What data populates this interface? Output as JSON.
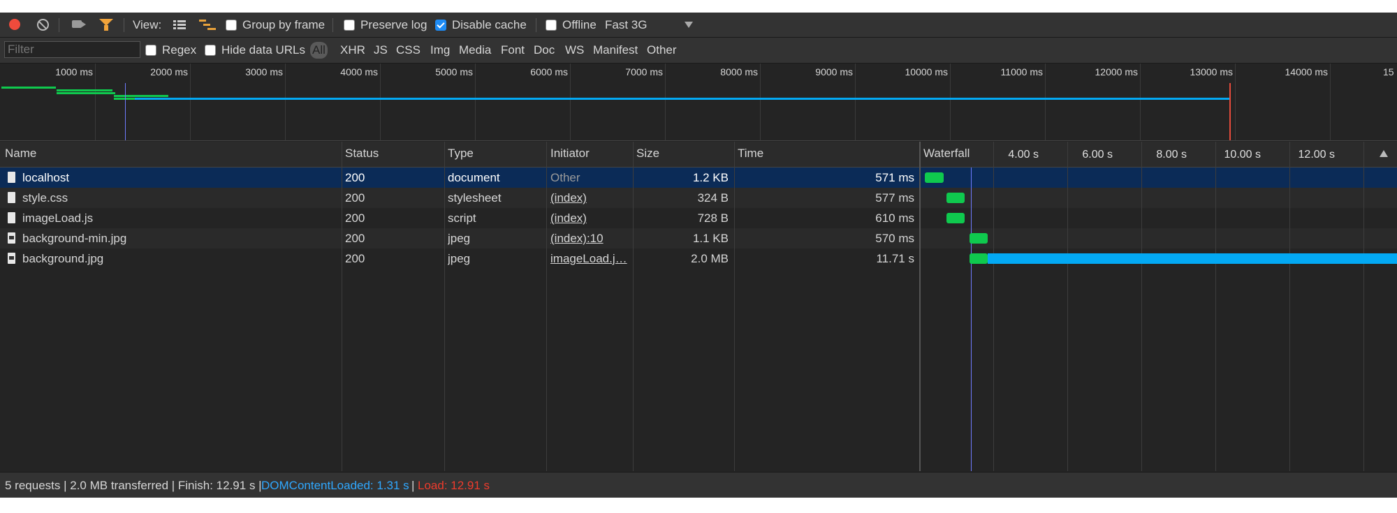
{
  "toolbar": {
    "view_label": "View:",
    "group_by_frame_label": "Group by frame",
    "group_by_frame_checked": false,
    "preserve_log_label": "Preserve log",
    "preserve_log_checked": false,
    "disable_cache_label": "Disable cache",
    "disable_cache_checked": true,
    "offline_label": "Offline",
    "offline_checked": false,
    "throttling_value": "Fast 3G"
  },
  "filterbar": {
    "filter_placeholder": "Filter",
    "filter_value": "",
    "regex_label": "Regex",
    "hide_data_urls_label": "Hide data URLs",
    "types": [
      "All",
      "XHR",
      "JS",
      "CSS",
      "Img",
      "Media",
      "Font",
      "Doc",
      "WS",
      "Manifest",
      "Other"
    ],
    "active_type": "All"
  },
  "overview": {
    "ticks": [
      "1000 ms",
      "2000 ms",
      "3000 ms",
      "4000 ms",
      "5000 ms",
      "6000 ms",
      "7000 ms",
      "8000 ms",
      "9000 ms",
      "10000 ms",
      "11000 ms",
      "12000 ms",
      "13000 ms",
      "14000 ms",
      "15"
    ]
  },
  "table": {
    "columns": {
      "name": "Name",
      "status": "Status",
      "type": "Type",
      "initiator": "Initiator",
      "size": "Size",
      "time": "Time",
      "waterfall": "Waterfall"
    },
    "waterfall_ticks": [
      "4.00 s",
      "6.00 s",
      "8.00 s",
      "10.00 s",
      "12.00 s"
    ],
    "rows": [
      {
        "name": "localhost",
        "status": "200",
        "type": "document",
        "initiator": "Other",
        "size": "1.2 KB",
        "time": "571 ms",
        "wf_start_s": 0.0,
        "wf_end_s": 0.57
      },
      {
        "name": "style.css",
        "status": "200",
        "type": "stylesheet",
        "initiator": "(index)",
        "size": "324 B",
        "time": "577 ms",
        "wf_start_s": 0.58,
        "wf_end_s": 1.16
      },
      {
        "name": "imageLoad.js",
        "status": "200",
        "type": "script",
        "initiator": "(index)",
        "size": "728 B",
        "time": "610 ms",
        "wf_start_s": 0.58,
        "wf_end_s": 1.19
      },
      {
        "name": "background-min.jpg",
        "status": "200",
        "type": "jpeg",
        "initiator": "(index):10",
        "size": "1.1 KB",
        "time": "570 ms",
        "wf_start_s": 1.2,
        "wf_end_s": 1.77
      },
      {
        "name": "background.jpg",
        "status": "200",
        "type": "jpeg",
        "initiator": "imageLoad.j…",
        "size": "2.0 MB",
        "time": "11.71 s",
        "wf_start_s": 1.2,
        "wf_end_s": 12.91
      }
    ]
  },
  "status": {
    "summary": "5 requests | 2.0 MB transferred | Finish: 12.91 s |",
    "dom_content_loaded": "DOMContentLoaded: 1.31 s",
    "separator": "|",
    "load": "Load: 12.91 s"
  },
  "colors": {
    "selected_row": "#0b2b57",
    "waiting_green": "#0fc94e",
    "download_blue": "#03a9f4",
    "dcl_line": "#6f7bff",
    "load_line": "#e64b3c",
    "dcl_text": "#2fa8ff",
    "load_text": "#ef3b2c"
  }
}
